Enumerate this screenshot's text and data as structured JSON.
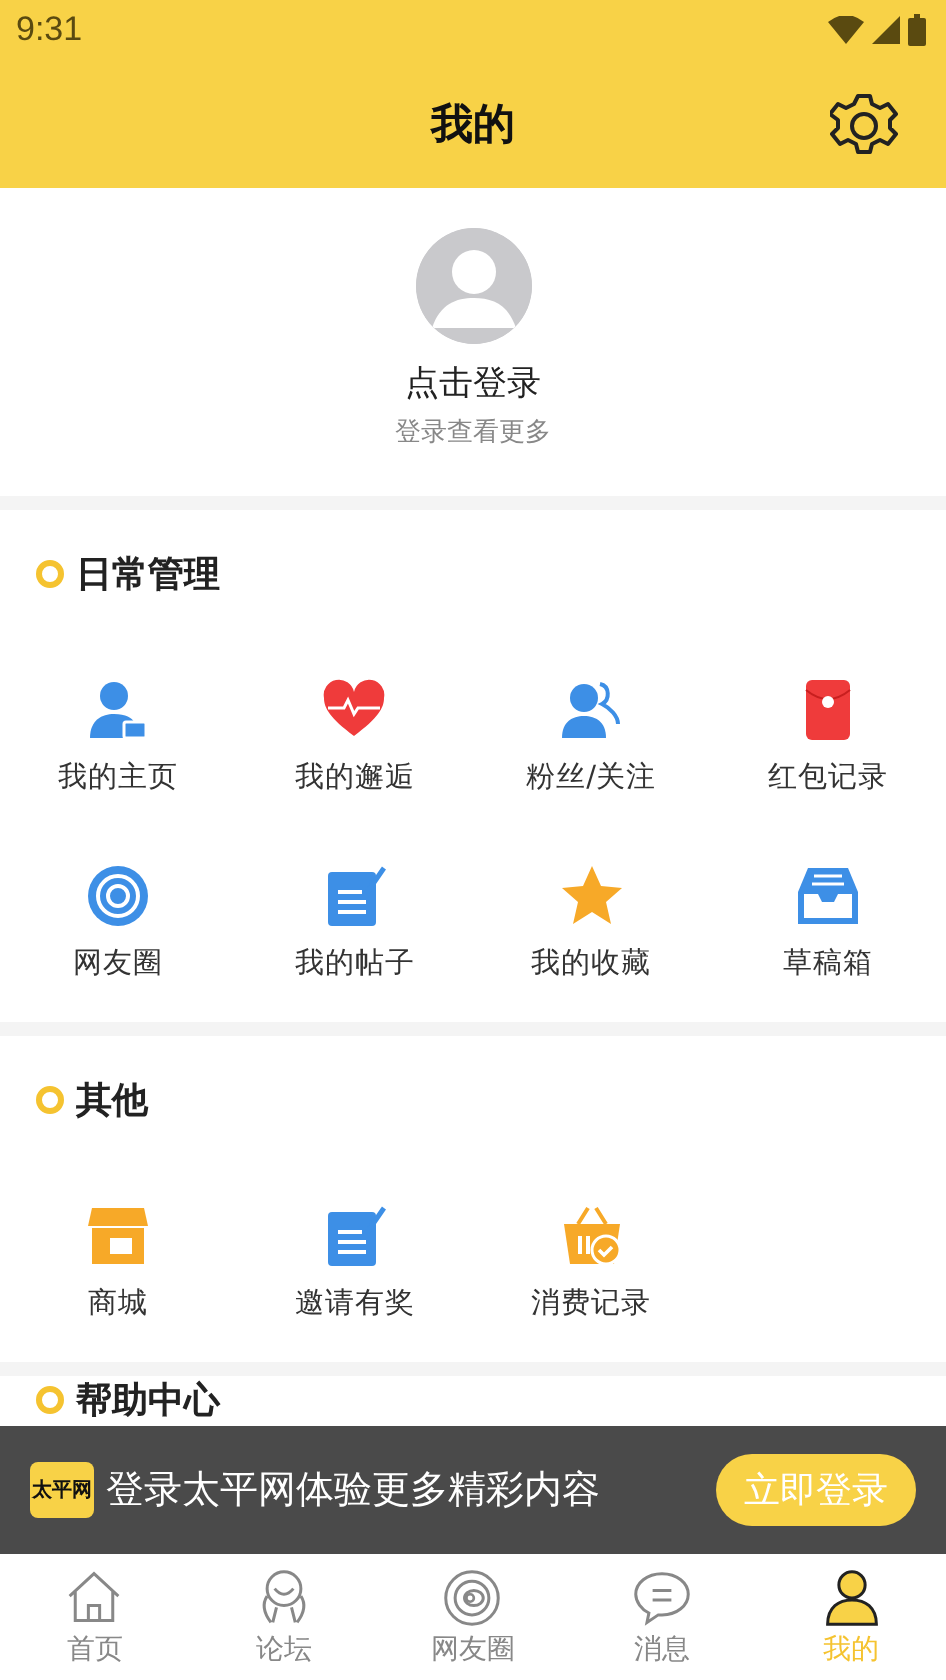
{
  "status_bar": {
    "time": "9:31"
  },
  "header": {
    "title": "我的"
  },
  "profile": {
    "name": "点击登录",
    "subtitle": "登录查看更多"
  },
  "sections": [
    {
      "title": "日常管理",
      "items": [
        "我的主页",
        "我的邂逅",
        "粉丝/关注",
        "红包记录",
        "网友圈",
        "我的帖子",
        "我的收藏",
        "草稿箱"
      ]
    },
    {
      "title": "其他",
      "items": [
        "商城",
        "邀请有奖",
        "消费记录"
      ]
    },
    {
      "title": "帮助中心"
    }
  ],
  "login_banner": {
    "logo": "太平网",
    "text": "登录太平网体验更多精彩内容",
    "button": "立即登录"
  },
  "tabs": [
    {
      "label": "首页",
      "selected": false
    },
    {
      "label": "论坛",
      "selected": false
    },
    {
      "label": "网友圈",
      "selected": false
    },
    {
      "label": "消息",
      "selected": false
    },
    {
      "label": "我的",
      "selected": true
    }
  ]
}
